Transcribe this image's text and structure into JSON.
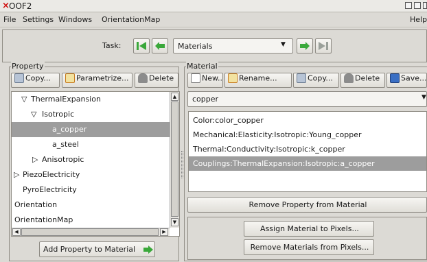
{
  "window": {
    "title": "OOF2",
    "close_glyph": "×",
    "minimize_glyph": "_",
    "maximize_glyph": "□"
  },
  "menu": {
    "file": "File",
    "settings": "Settings",
    "windows": "Windows",
    "orientationmap": "OrientationMap",
    "help": "Help"
  },
  "task": {
    "label": "Task:",
    "selected": "Materials"
  },
  "property_panel": {
    "legend": "Property",
    "buttons": {
      "copy": "Copy...",
      "parametrize": "Parametrize...",
      "delete": "Delete"
    },
    "tree": [
      {
        "label": "ThermalExpansion",
        "expander": "▽",
        "level": 1
      },
      {
        "label": "Isotropic",
        "expander": "▽",
        "level": 2
      },
      {
        "label": "a_copper",
        "expander": "",
        "level": 3,
        "selected": true
      },
      {
        "label": "a_steel",
        "expander": "",
        "level": 3
      },
      {
        "label": "Anisotropic",
        "expander": "▷",
        "level": 2
      },
      {
        "label": "PiezoElectricity",
        "expander": "▷",
        "level": 0
      },
      {
        "label": "PyroElectricity",
        "expander": "",
        "level": 0
      },
      {
        "label": "Orientation",
        "expander": "",
        "level": -1
      },
      {
        "label": "OrientationMap",
        "expander": "",
        "level": -1
      }
    ],
    "add_button": "Add Property to Material"
  },
  "material_panel": {
    "legend": "Material",
    "buttons": {
      "new": "New...",
      "rename": "Rename...",
      "copy": "Copy...",
      "delete": "Delete",
      "save": "Save..."
    },
    "selected_material": "copper",
    "properties": [
      "Color:color_copper",
      "Mechanical:Elasticity:Isotropic:Young_copper",
      "Thermal:Conductivity:Isotropic:k_copper",
      "Couplings:ThermalExpansion:Isotropic:a_copper"
    ],
    "remove_property_button": "Remove Property from Material",
    "assign_button": "Assign Material to Pixels...",
    "remove_materials_button": "Remove Materials from Pixels..."
  },
  "colors": {
    "selection": "#9d9d9d",
    "accent_green": "#3aa83a",
    "close_red": "#d01010"
  }
}
